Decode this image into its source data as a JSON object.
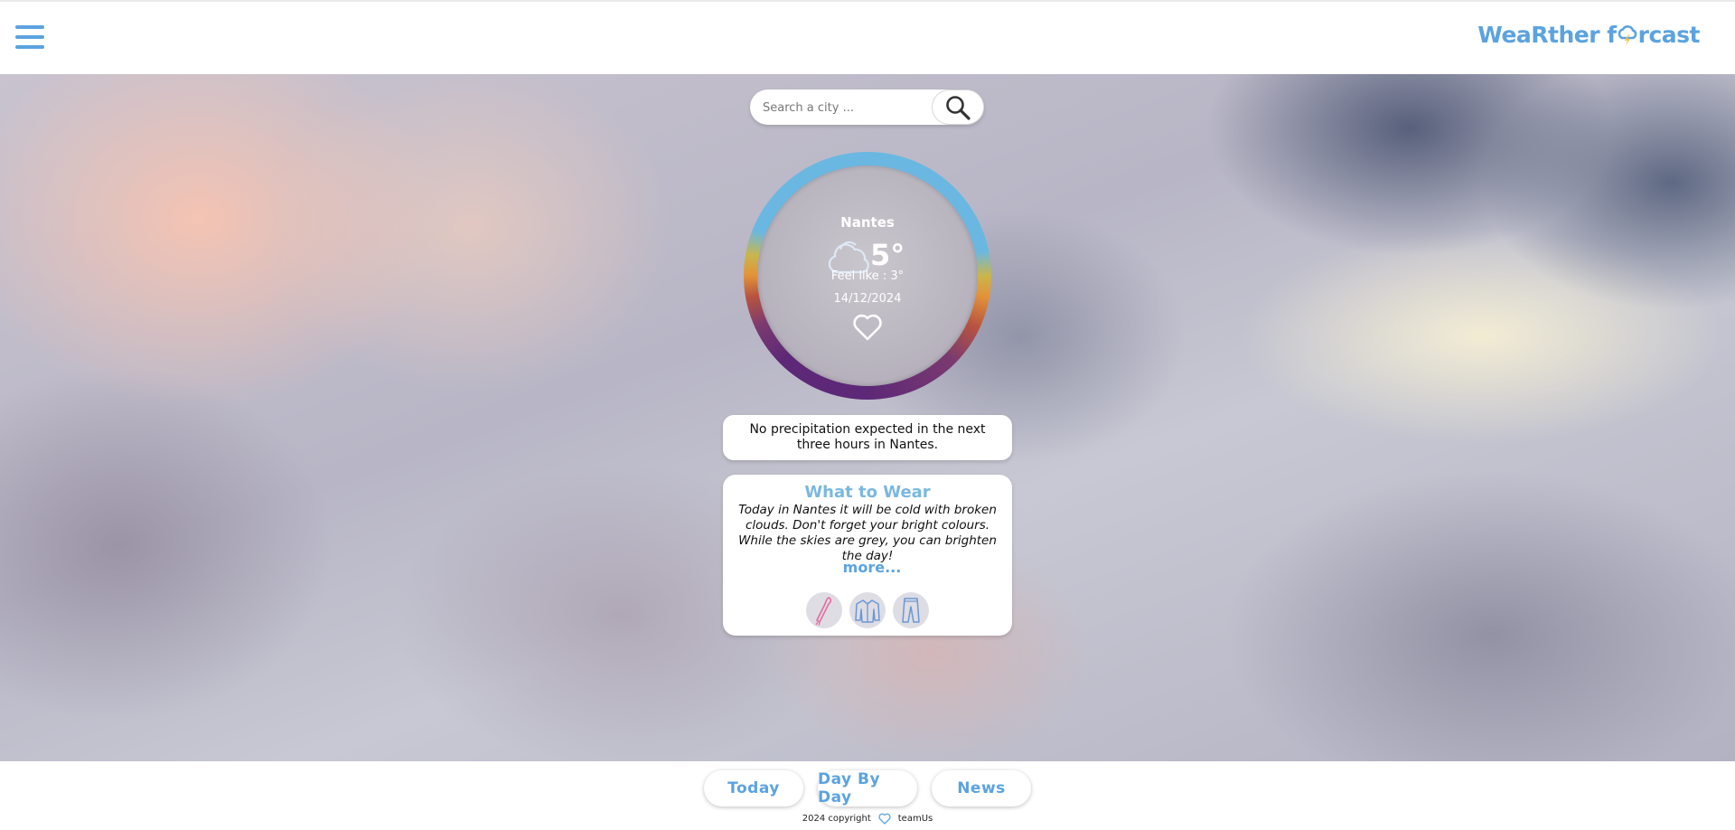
{
  "app": {
    "logo": {
      "part1": "WeaRther f",
      "part2": "rcast"
    }
  },
  "search": {
    "placeholder": "Search a city ..."
  },
  "weather": {
    "city": "Nantes",
    "temperature": "5°",
    "feels_like": "Feel like : 3°",
    "date": "14/12/2024",
    "icon": "cloud-icon"
  },
  "precipitation": {
    "message": "No precipitation expected in the next three hours in Nantes."
  },
  "what_to_wear": {
    "title": "What to Wear",
    "text": "Today in Nantes it will be cold with broken clouds. Don't forget your bright colours. While the skies are grey, you can brighten the day!",
    "more_label": "more...",
    "items": [
      "scarf-icon",
      "jacket-icon",
      "pants-icon"
    ]
  },
  "nav": {
    "today": "Today",
    "day_by_day": "Day By Day",
    "news": "News"
  },
  "footer": {
    "copyright": "2024 copyright",
    "team": "teamUs"
  },
  "colors": {
    "accent": "#5ba3e0",
    "title_blue": "#7ab8e0",
    "ring_purple": "#5d2877",
    "ring_blue": "#6ab8e2"
  }
}
